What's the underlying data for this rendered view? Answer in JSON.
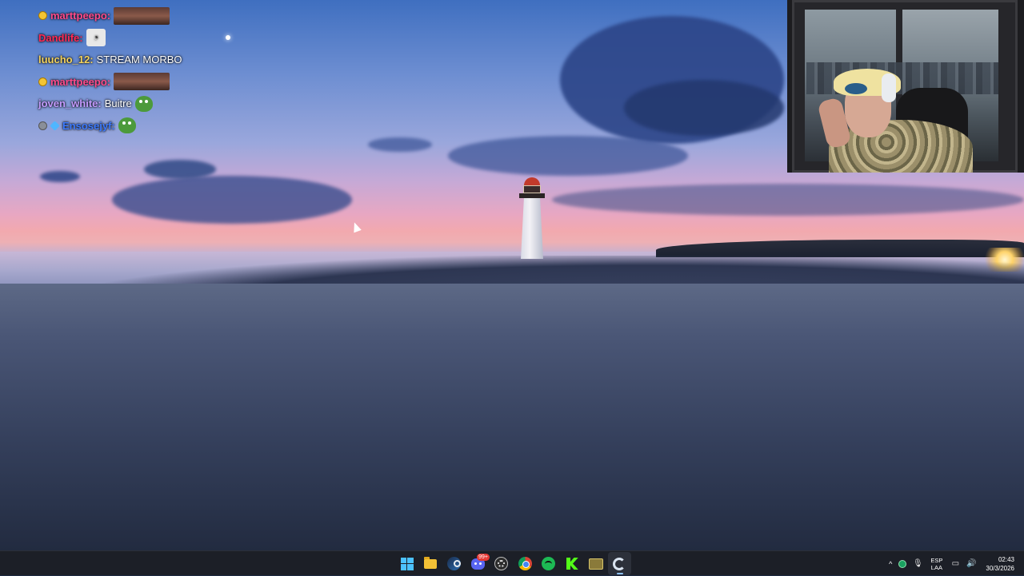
{
  "chat": {
    "messages": [
      {
        "badges": [
          "yellow"
        ],
        "user": "marttpeepo:",
        "user_color": "#ff4b8b",
        "text": "",
        "emote": "image"
      },
      {
        "badges": [],
        "user": "Dandlife:",
        "user_color": "#ff2a55",
        "text": "",
        "emote": "cat"
      },
      {
        "badges": [],
        "user": "luucho_12:",
        "user_color": "#f4d35e",
        "text": "STREAM MORBO",
        "emote": ""
      },
      {
        "badges": [
          "yellow"
        ],
        "user": "marttpeepo:",
        "user_color": "#ff4b8b",
        "text": "",
        "emote": "image"
      },
      {
        "badges": [],
        "user": "joven_white:",
        "user_color": "#c39bff",
        "text": "Buitre",
        "emote": "pepe"
      },
      {
        "badges": [
          "gray",
          "blue"
        ],
        "user": "Ensosejyf:",
        "user_color": "#3d7bff",
        "text": "",
        "emote": "pepe"
      }
    ]
  },
  "taskbar": {
    "apps": [
      {
        "name": "start",
        "icon": "windows-start-icon",
        "active": false
      },
      {
        "name": "file-explorer",
        "icon": "folder-icon",
        "active": false
      },
      {
        "name": "steam",
        "icon": "steam-icon",
        "active": false
      },
      {
        "name": "discord",
        "icon": "discord-icon",
        "active": false,
        "badge": "99+"
      },
      {
        "name": "obs",
        "icon": "obs-icon",
        "active": false
      },
      {
        "name": "chrome",
        "icon": "chrome-icon",
        "active": false
      },
      {
        "name": "spotify",
        "icon": "spotify-icon",
        "active": false
      },
      {
        "name": "kick",
        "icon": "kick-icon",
        "active": false
      },
      {
        "name": "game",
        "icon": "game-icon",
        "active": false
      },
      {
        "name": "app",
        "icon": "c-app-icon",
        "active": true
      }
    ],
    "tray": {
      "chevron": "^",
      "lang_top": "ESP",
      "lang_bottom": "LAA",
      "time": "02:43",
      "date": "30/3/2026"
    }
  },
  "colors": {
    "taskbar_bg": "#1c1f27",
    "accent": "#4cc2ff"
  }
}
